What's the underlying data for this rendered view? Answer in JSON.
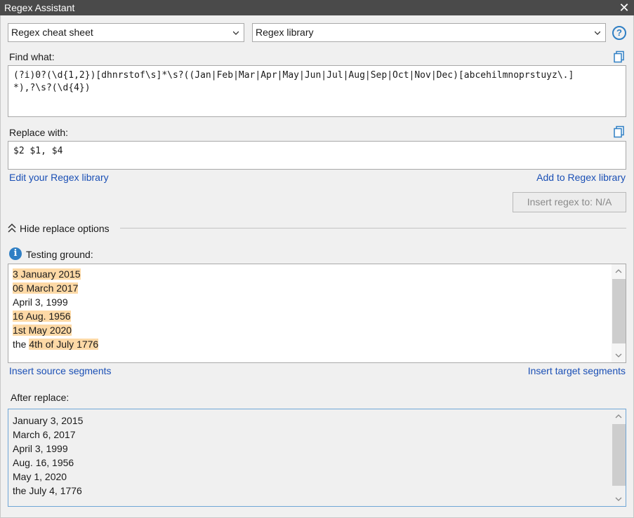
{
  "window": {
    "title": "Regex Assistant"
  },
  "toolbar": {
    "cheat_sheet": "Regex cheat sheet",
    "library": "Regex library"
  },
  "find": {
    "label": "Find what:",
    "line1": "(?i)0?(\\d{1,2})[dhnrstof\\s]*\\s?((Jan|Feb|Mar|Apr|May|Jun|Jul|Aug|Sep|Oct|Nov|Dec)[abcehilmnoprstuyz\\.]",
    "line2": "*),?\\s?(\\d{4})"
  },
  "replace": {
    "label": "Replace with:",
    "value": "$2 $1, $4"
  },
  "links": {
    "edit_library": "Edit your Regex library",
    "add_library": "Add to Regex library",
    "insert_source": "Insert source segments",
    "insert_target": "Insert target segments"
  },
  "insert_button": "Insert regex to: N/A",
  "options_toggle": "Hide replace options",
  "testing": {
    "label": "Testing ground:",
    "lines": [
      {
        "pre": "",
        "match": "3 January 2015"
      },
      {
        "pre": "",
        "match": "06 March 2017"
      },
      {
        "pre": "April 3, 1999",
        "match": ""
      },
      {
        "pre": "",
        "match": "16 Aug. 1956"
      },
      {
        "pre": "",
        "match": "1st May 2020"
      },
      {
        "pre": "the ",
        "match": "4th of July 1776"
      }
    ]
  },
  "after": {
    "label": "After replace:",
    "lines": [
      "January 3, 2015",
      "March 6, 2017",
      "April 3, 1999",
      "Aug. 16, 1956",
      "May 1, 2020",
      "the July 4, 1776"
    ]
  },
  "colors": {
    "titlebar": "#4a4a4a",
    "link": "#1a4fb5",
    "match_highlight": "#fdd9a6",
    "accent": "#2f7fc4",
    "focus_border": "#6fa6d6"
  },
  "icons": [
    "close-icon",
    "chevron-down-icon",
    "help-icon",
    "copy-icon",
    "chevron-up-icon",
    "info-icon"
  ]
}
